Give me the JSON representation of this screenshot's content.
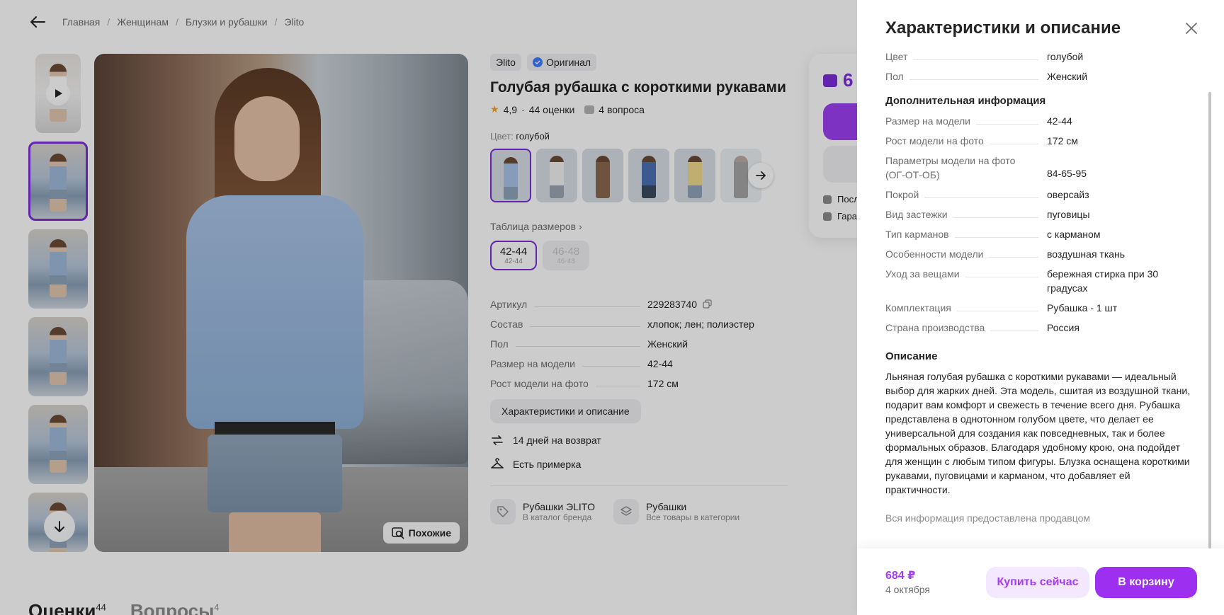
{
  "breadcrumbs": [
    "Главная",
    "Женщинам",
    "Блузки и рубашки",
    "Эlito"
  ],
  "product": {
    "brand": "Эlito",
    "original_badge": "Оригинал",
    "title": "Голубая рубашка с короткими рукавами",
    "rating": "4,9",
    "reviews": "44 оценки",
    "questions": "4 вопроса",
    "color_label": "Цвет:",
    "color_value": "голубой",
    "sizes_link": "Таблица размеров",
    "sizes": [
      {
        "big": "42-44",
        "small": "42-44"
      },
      {
        "big": "46-48",
        "small": "46-48"
      }
    ],
    "specs": [
      {
        "key": "Артикул",
        "value": "229283740"
      },
      {
        "key": "Состав",
        "value": "хлопок; лен; полиэстер"
      },
      {
        "key": "Пол",
        "value": "Женский"
      },
      {
        "key": "Размер на модели",
        "value": "42-44"
      },
      {
        "key": "Рост модели на фото",
        "value": "172 см"
      }
    ],
    "charac_button": "Характеристики и описание",
    "features": [
      "14 дней на возврат",
      "Есть примерка"
    ],
    "categories": [
      {
        "title": "Рубашки ЭLITO",
        "sub": "В каталог бренда"
      },
      {
        "title": "Рубашки",
        "sub": "Все товары в категории"
      }
    ],
    "similar_button": "Похожие",
    "buy_card_price": "6",
    "buy_card_lines": [
      "Посл",
      "Гара"
    ]
  },
  "bottom_tabs": [
    {
      "label": "Оценки",
      "count": "44"
    },
    {
      "label": "Вопросы",
      "count": "4"
    }
  ],
  "drawer": {
    "title": "Характеристики и описание",
    "top_rows": [
      {
        "key": "Цвет",
        "value": "голубой"
      },
      {
        "key": "Пол",
        "value": "Женский"
      }
    ],
    "additional_title": "Дополнительная информация",
    "additional_rows": [
      {
        "key": "Размер на модели",
        "value": "42-44"
      },
      {
        "key": "Рост модели на фото",
        "value": "172 см"
      },
      {
        "key": "Параметры модели на фото (ОГ-ОТ-ОБ)",
        "value": "84-65-95"
      },
      {
        "key": "Покрой",
        "value": "оверсайз"
      },
      {
        "key": "Вид застежки",
        "value": "пуговицы"
      },
      {
        "key": "Тип карманов",
        "value": "с карманом"
      },
      {
        "key": "Особенности модели",
        "value": "воздушная ткань"
      },
      {
        "key": "Уход за вещами",
        "value": "бережная стирка при 30 градусах"
      },
      {
        "key": "Комплектация",
        "value": "Рубашка - 1 шт"
      },
      {
        "key": "Страна производства",
        "value": "Россия"
      }
    ],
    "description_title": "Описание",
    "description": "Льняная голубая рубашка с короткими рукавами — идеальный выбор для жарких дней. Эта модель, сшитая из воздушной ткани, подарит вам комфорт и свежесть в течение всего дня. Рубашка представлена в однотонном голубом цвете, что делает ее универсальной для создания как повседневных, так и более формальных образов. Благодаря удобному крою, она подойдет для женщин с любым типом фигуры. Блузка оснащена короткими рукавами, пуговицами и карманом, что добавляет ей практичности.",
    "seller_note": "Вся информация предоставлена продавцом",
    "footer": {
      "price": "684 ₽",
      "delivery_date": "4 октября",
      "buy_now": "Купить сейчас",
      "add_to_cart": "В корзину"
    }
  },
  "colors": {
    "accent": "#9d2ff0",
    "accent_light": "#f4e8ff",
    "rating_star": "#f5a623"
  },
  "icons": [
    "back-arrow-icon",
    "play-icon",
    "arrow-down-icon",
    "search-similar-icon",
    "verified-icon",
    "star-icon",
    "question-icon",
    "chevron-right-icon",
    "arrow-right-icon",
    "copy-icon",
    "return-icon",
    "hanger-icon",
    "tag-icon",
    "layers-icon",
    "wallet-icon",
    "close-icon"
  ]
}
